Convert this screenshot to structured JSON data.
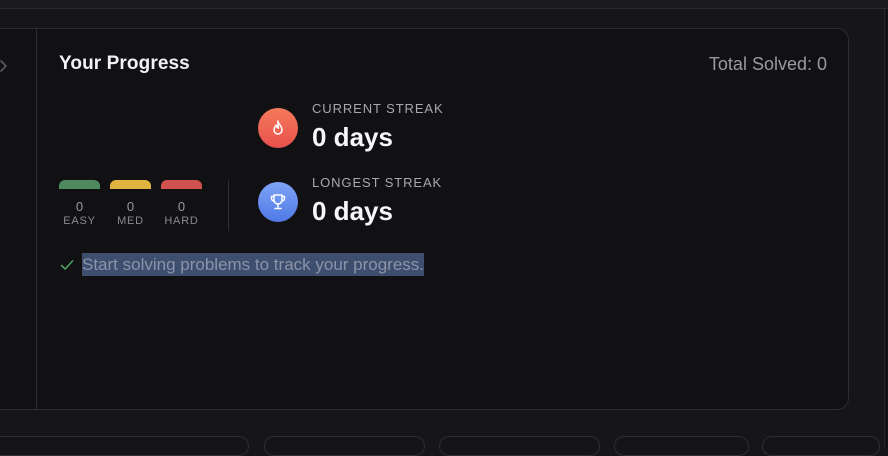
{
  "panel": {
    "title": "Your Progress",
    "total_solved": "Total Solved: 0"
  },
  "difficulty": [
    {
      "count": "0",
      "label": "EASY",
      "color": "#4f8a5e"
    },
    {
      "count": "0",
      "label": "MED",
      "color": "#e0b43e"
    },
    {
      "count": "0",
      "label": "HARD",
      "color": "#d0524f"
    }
  ],
  "streaks": {
    "current": {
      "label": "CURRENT STREAK",
      "value": "0 days",
      "icon": "flame-icon"
    },
    "longest": {
      "label": "LONGEST STREAK",
      "value": "0 days",
      "icon": "trophy-icon"
    }
  },
  "hint": {
    "text": "Start solving problems to track your progress.",
    "icon": "check-icon"
  },
  "colors": {
    "background": "#111113",
    "current_streak_gradient": [
      "#f47a5b",
      "#e8514c"
    ],
    "longest_streak_gradient": [
      "#7ea4f6",
      "#4f79e6"
    ],
    "check": "#4f9e62",
    "selection": "#3e4e6e"
  }
}
